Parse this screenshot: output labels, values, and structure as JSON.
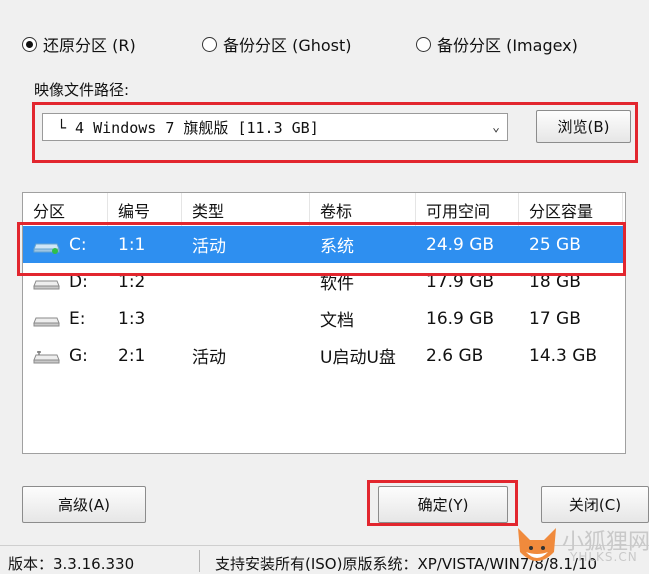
{
  "modes": [
    {
      "label": "还原分区 (R)",
      "selected": true
    },
    {
      "label": "备份分区 (Ghost)",
      "selected": false
    },
    {
      "label": "备份分区 (Imagex)",
      "selected": false
    }
  ],
  "image_path": {
    "label": "映像文件路径:",
    "value": "└ 4 Windows 7 旗舰版 [11.3 GB]",
    "browse_label": "浏览(B)"
  },
  "table": {
    "headers": [
      "分区",
      "编号",
      "类型",
      "卷标",
      "可用空间",
      "分区容量"
    ],
    "rows": [
      {
        "drive": "C:",
        "num": "1:1",
        "type": "活动",
        "label": "系统",
        "free": "24.9 GB",
        "size": "25 GB",
        "selected": true
      },
      {
        "drive": "D:",
        "num": "1:2",
        "type": "",
        "label": "软件",
        "free": "17.9 GB",
        "size": "18 GB",
        "selected": false
      },
      {
        "drive": "E:",
        "num": "1:3",
        "type": "",
        "label": "文档",
        "free": "16.9 GB",
        "size": "17 GB",
        "selected": false
      },
      {
        "drive": "G:",
        "num": "2:1",
        "type": "活动",
        "label": "U启动U盘",
        "free": "2.6 GB",
        "size": "14.3 GB",
        "selected": false
      }
    ]
  },
  "buttons": {
    "advanced": "高级(A)",
    "ok": "确定(Y)",
    "close": "关闭(C)"
  },
  "status": {
    "version": "版本：3.3.16.330",
    "support": "支持安装所有(ISO)原版系统：XP/VISTA/WIN7/8/8.1/10"
  },
  "watermark": {
    "text": "小狐狸网",
    "url": "YHLKS.CN"
  },
  "colors": {
    "selection": "#2e8ff0",
    "highlight": "#e2262e"
  }
}
